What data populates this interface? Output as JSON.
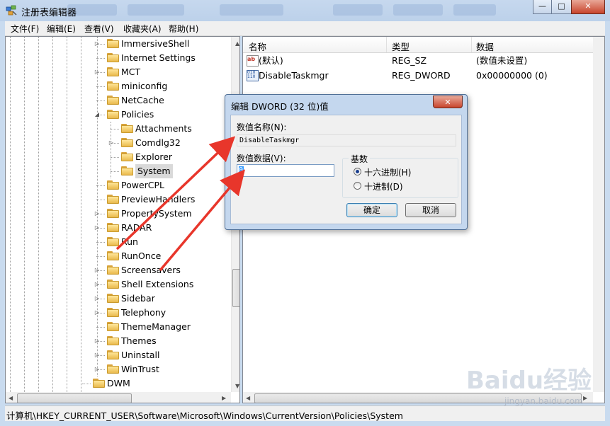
{
  "window": {
    "title": "注册表编辑器",
    "controls": [
      "—",
      "□",
      "✕"
    ]
  },
  "menu": [
    "文件(F)",
    "编辑(E)",
    "查看(V)",
    "收藏夹(A)",
    "帮助(H)"
  ],
  "tree": {
    "items": [
      {
        "label": "ImmersiveShell",
        "expandable": true
      },
      {
        "label": "Internet Settings",
        "expandable": false
      },
      {
        "label": "MCT",
        "expandable": true
      },
      {
        "label": "miniconfig",
        "expandable": false
      },
      {
        "label": "NetCache",
        "expandable": false
      },
      {
        "label": "Policies",
        "expandable": true,
        "expanded": true
      },
      {
        "label": "Attachments",
        "expandable": false,
        "child": true
      },
      {
        "label": "Comdlg32",
        "expandable": true,
        "child": true
      },
      {
        "label": "Explorer",
        "expandable": false,
        "child": true
      },
      {
        "label": "System",
        "expandable": false,
        "child": true,
        "selected": true
      },
      {
        "label": "PowerCPL",
        "expandable": false
      },
      {
        "label": "PreviewHandlers",
        "expandable": false
      },
      {
        "label": "PropertySystem",
        "expandable": true
      },
      {
        "label": "RADAR",
        "expandable": true
      },
      {
        "label": "Run",
        "expandable": false
      },
      {
        "label": "RunOnce",
        "expandable": false
      },
      {
        "label": "Screensavers",
        "expandable": true
      },
      {
        "label": "Shell Extensions",
        "expandable": true
      },
      {
        "label": "Sidebar",
        "expandable": true
      },
      {
        "label": "Telephony",
        "expandable": true
      },
      {
        "label": "ThemeManager",
        "expandable": false
      },
      {
        "label": "Themes",
        "expandable": true
      },
      {
        "label": "Uninstall",
        "expandable": true
      },
      {
        "label": "WinTrust",
        "expandable": true
      },
      {
        "label": "DWM",
        "expandable": false,
        "top": true
      }
    ]
  },
  "list": {
    "columns": [
      "名称",
      "类型",
      "数据"
    ],
    "rows": [
      {
        "icon": "string-value-icon",
        "name": "(默认)",
        "type": "REG_SZ",
        "data": "(数值未设置)"
      },
      {
        "icon": "binary-value-icon",
        "name": "DisableTaskmgr",
        "type": "REG_DWORD",
        "data": "0x00000000 (0)"
      }
    ]
  },
  "status": {
    "path": "计算机\\HKEY_CURRENT_USER\\Software\\Microsoft\\Windows\\CurrentVersion\\Policies\\System"
  },
  "dialog": {
    "title": "编辑 DWORD (32 位)值",
    "close": "✕",
    "name_label": "数值名称(N):",
    "name_value": "DisableTaskmgr",
    "data_label": "数值数据(V):",
    "data_value": "0",
    "base_label": "基数",
    "radix_hex": "十六进制(H)",
    "radix_dec": "十进制(D)",
    "ok": "确定",
    "cancel": "取消"
  },
  "watermark": {
    "logo": "Baidu经验",
    "url": "jingyan.baidu.com"
  },
  "colors": {
    "accent_arrow": "#e8362b",
    "selection": "#3399ff"
  }
}
